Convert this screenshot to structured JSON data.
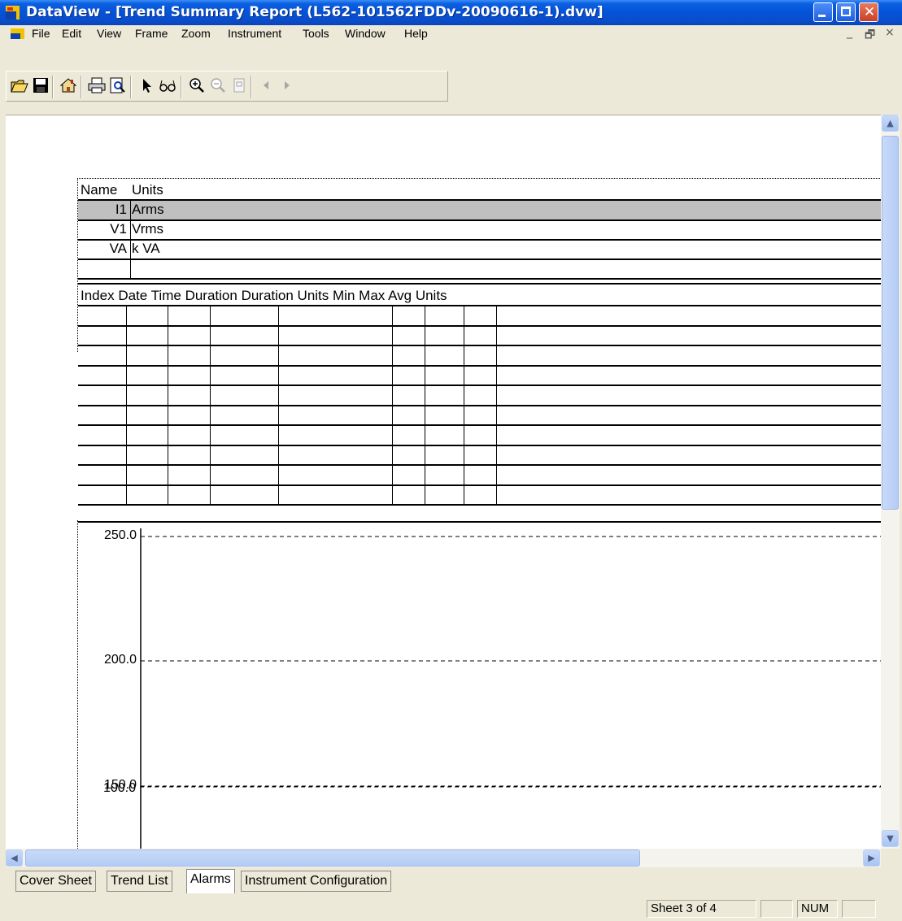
{
  "window": {
    "title": "DataView - [Trend Summary Report (L562-101562FDDv-20090616-1).dvw]"
  },
  "menu": {
    "items": [
      "File",
      "Edit",
      "View",
      "Frame",
      "Zoom",
      "Instrument",
      "Tools",
      "Window",
      "Help"
    ],
    "mdi_minimize": "_",
    "mdi_restore": "🗗",
    "mdi_close": "×"
  },
  "toolbar": {
    "icons": [
      "open-icon",
      "save-icon",
      "home-icon",
      "print-icon",
      "print-preview-icon",
      "pointer-icon",
      "view-glasses-icon",
      "zoom-in-icon",
      "zoom-out-icon",
      "page-icon",
      "previous-icon",
      "next-icon"
    ]
  },
  "channels_table": {
    "header_name": "Name",
    "header_units": "Units",
    "rows": [
      {
        "name": "I1",
        "units": "Arms",
        "selected": true
      },
      {
        "name": "V1",
        "units": "Vrms",
        "selected": false
      },
      {
        "name": "VA",
        "units": "k VA",
        "selected": false
      },
      {
        "name": "",
        "units": "",
        "selected": false
      }
    ]
  },
  "events_table": {
    "headers": [
      "Index",
      "Date",
      "Time",
      "Duration",
      "Duration Units",
      "Min",
      "Max",
      "Avg",
      "Units"
    ],
    "empty_row_count": 10
  },
  "chart_data": {
    "type": "line",
    "title": "",
    "xlabel": "",
    "ylabel": "",
    "y_ticks": [
      "250.0",
      "200.0",
      "150.0",
      "100.0"
    ],
    "grid": "dashed horizontal",
    "series": []
  },
  "tabs": {
    "items": [
      "Cover Sheet",
      "Trend List",
      "Alarms",
      "Instrument Configuration"
    ],
    "active": "Alarms"
  },
  "status": {
    "sheet": "Sheet 3 of 4",
    "num": "NUM"
  },
  "colors": {
    "title_bar": "#0453d8",
    "selected_row": "#c0c0c0"
  }
}
